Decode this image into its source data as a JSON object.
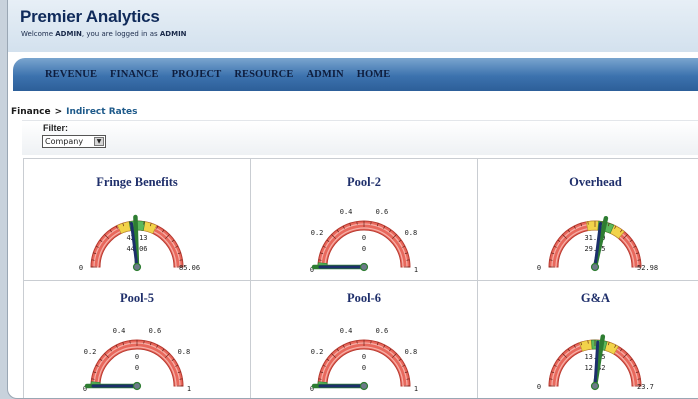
{
  "app": {
    "title": "Premier Analytics",
    "welcome_prefix": "Welcome ",
    "user": "ADMIN",
    "welcome_middle": ", you are logged in as ",
    "role": "ADMIN"
  },
  "nav": {
    "items": [
      "REVENUE",
      "FINANCE",
      "PROJECT",
      "RESOURCE",
      "ADMIN",
      "HOME"
    ]
  },
  "breadcrumb": {
    "parent": "Finance",
    "separator": ">",
    "current": "Indirect Rates"
  },
  "filter": {
    "label": "Filter:",
    "selected": "Company"
  },
  "colors": {
    "nav_gradient": "#3c72ae",
    "title_text": "#1f2f6b",
    "gauge_red": "#e8685c",
    "gauge_yellow": "#f2d34a",
    "gauge_green": "#5cb85c",
    "needle": "#1c2f6a"
  },
  "gauges": [
    {
      "title": "Fringe Benefits",
      "style": "range",
      "min_label": "0",
      "max_label": "85.06",
      "values": [
        "42.13",
        "44.06"
      ],
      "needle_fraction": 0.49,
      "band_fraction": 0.5
    },
    {
      "title": "Pool-2",
      "style": "scale",
      "ticks": [
        "0",
        "0.2",
        "0.4",
        "0.6",
        "0.8",
        "1"
      ],
      "values": [
        "0",
        "0"
      ],
      "needle_fraction": 0.0,
      "band_fraction": 0.0
    },
    {
      "title": "Overhead",
      "style": "range",
      "min_label": "0",
      "max_label": "52.98",
      "values": [
        "31.49",
        "29.95"
      ],
      "needle_fraction": 0.57,
      "band_fraction": 0.58
    },
    {
      "title": "Pool-5",
      "style": "scale",
      "ticks": [
        "0",
        "0.2",
        "0.4",
        "0.6",
        "0.8",
        "1"
      ],
      "values": [
        "0",
        "0"
      ],
      "needle_fraction": 0.0,
      "band_fraction": 0.0
    },
    {
      "title": "Pool-6",
      "style": "scale",
      "ticks": [
        "0",
        "0.2",
        "0.4",
        "0.6",
        "0.8",
        "1"
      ],
      "values": [
        "0",
        "0"
      ],
      "needle_fraction": 0.0,
      "band_fraction": 0.0
    },
    {
      "title": "G&A",
      "style": "range",
      "min_label": "0",
      "max_label": "23.7",
      "values": [
        "13.85",
        "12.42"
      ],
      "needle_fraction": 0.55,
      "band_fraction": 0.53
    }
  ]
}
